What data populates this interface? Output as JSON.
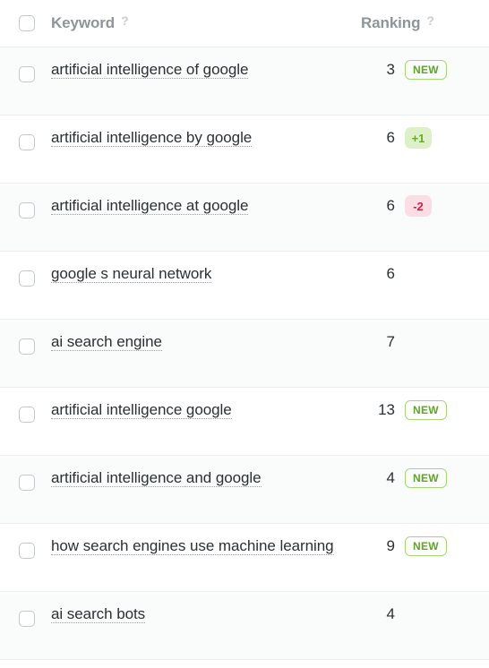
{
  "table": {
    "header": {
      "select_all_checkbox": "",
      "keyword_label": "Keyword",
      "ranking_label": "Ranking",
      "help_icon": "?"
    },
    "rows": [
      {
        "keyword": "artificial intelligence of google",
        "ranking": "3",
        "badge": {
          "type": "new",
          "text": "NEW"
        }
      },
      {
        "keyword": "artificial intelligence by google",
        "ranking": "6",
        "badge": {
          "type": "up",
          "text": "+1"
        }
      },
      {
        "keyword": "artificial intelligence at google",
        "ranking": "6",
        "badge": {
          "type": "down",
          "text": "-2"
        }
      },
      {
        "keyword": "google s neural network",
        "ranking": "6",
        "badge": {
          "type": "none",
          "text": ""
        }
      },
      {
        "keyword": "ai search engine",
        "ranking": "7",
        "badge": {
          "type": "none",
          "text": ""
        }
      },
      {
        "keyword": "artificial intelligence google",
        "ranking": "13",
        "badge": {
          "type": "new",
          "text": "NEW"
        }
      },
      {
        "keyword": "artificial intelligence and google",
        "ranking": "4",
        "badge": {
          "type": "new",
          "text": "NEW"
        }
      },
      {
        "keyword": "how search engines use machine learning",
        "ranking": "9",
        "badge": {
          "type": "new",
          "text": "NEW"
        }
      },
      {
        "keyword": "ai search bots",
        "ranking": "4",
        "badge": {
          "type": "none",
          "text": ""
        }
      }
    ]
  },
  "colors": {
    "text": "#2b3033",
    "header_text": "#8d949a",
    "row_alt_bg": "#fafbfb",
    "row_border": "#edeff1",
    "badge_new_border": "#a8d872",
    "badge_new_text": "#5fa528",
    "badge_up_bg": "#ddf0c8",
    "badge_up_text": "#67ab2c",
    "badge_down_bg": "#fbdde4",
    "badge_down_text": "#d1224a"
  }
}
